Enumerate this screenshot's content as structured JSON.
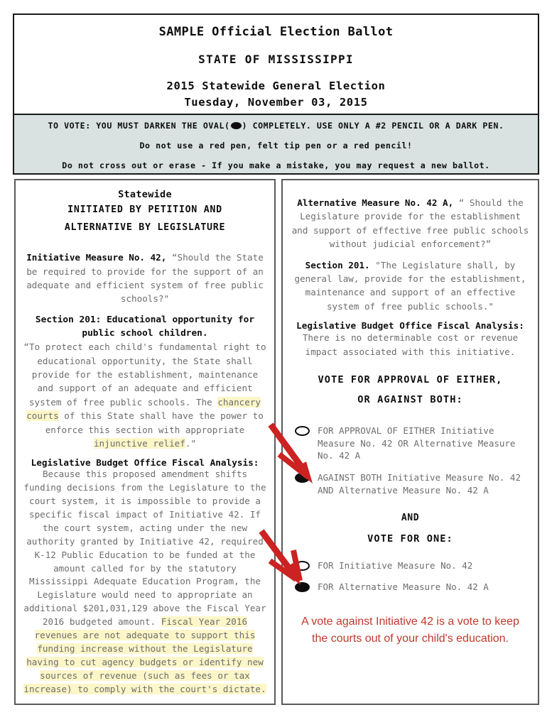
{
  "header": {
    "title_main": "SAMPLE Official Election Ballot",
    "title_state": "STATE OF MISSISSIPPI",
    "title_election": "2015 Statewide General Election",
    "title_date": "Tuesday, November 03, 2015"
  },
  "instructions": {
    "line1_before_oval": "TO VOTE: YOU MUST DARKEN THE OVAL(",
    "line1_after_oval": ") COMPLETELY. USE ONLY A #2 PENCIL OR A DARK PEN.",
    "line2": "Do not use a red pen, felt tip pen or a red pencil!",
    "line3": "Do not cross out or erase - If you make a mistake, you may request a new ballot."
  },
  "left_column": {
    "heading_statewide": "Statewide",
    "heading_initiated_l1": "INITIATED BY PETITION AND",
    "heading_initiated_l2": "ALTERNATIVE BY LEGISLATURE",
    "initiative_lead": "Initiative Measure No. 42,",
    "initiative_text": " “Should the State be required to provide for the support of an adequate and efficient system of free public schools?\"",
    "section_head_l1": "Section 201: Educational opportunity for",
    "section_head_l2": "public school children.",
    "section_text_a": "“To protect each child's fundamental right to educational opportunity, the State shall provide for the establishment, maintenance and support of an adequate and efficient system of free public schools. The ",
    "section_hl_1": "chancery courts",
    "section_text_b": " of this State shall have the power to enforce this section with appropriate ",
    "section_hl_2": "injunctive relief",
    "section_text_c": ".\"",
    "lbo_head": "Legislative Budget Office Fiscal Analysis:",
    "lbo_text_a": "Because this proposed amendment shifts funding decisions from the Legislature to the court system, it is impossible to provide a specific fiscal impact of Initiative 42.  If the court system, acting under the new authority granted by Initiative 42, required K-12 Public Education to be funded at the amount called for by the statutory Mississippi Adequate Education Program, the Legislature would need to appropriate an additional $201,031,129 above the Fiscal Year 2016 budgeted amount.  ",
    "lbo_hl_block": "Fiscal Year 2016 revenues are not adequate to support this funding increase without the Legislature having to cut agency budgets or identify new sources of revenue (such as fees or tax increase) to comply with the court's dictate."
  },
  "right_column": {
    "alt_lead": "Alternative Measure No. 42 A,",
    "alt_text": " “ Should the Legislature provide for the establishment and support of effective free public schools without judicial enforcement?”",
    "section_lead": "Section 201.",
    "section_text": " \"The Legislature shall, by general law, provide for the establishment, maintenance and support of an effective system of free public schools.\"",
    "lbo_head": "Legislative Budget Office Fiscal Analysis:",
    "lbo_text": "There is no determinable cost or revenue impact associated with this initiative.",
    "vote_head_l1": "VOTE FOR APPROVAL OF EITHER,",
    "vote_head_l2": "OR AGAINST BOTH:",
    "option_1": "FOR APPROVAL OF EITHER Initiative Measure No. 42 OR Alternative Measure No. 42 A",
    "option_1_state": "empty",
    "option_2": "AGAINST BOTH Initiative Measure No. 42 AND Alternative Measure No. 42 A",
    "option_2_state": "filled",
    "and_word": "AND",
    "vote_one_head": "VOTE FOR ONE:",
    "option_3": "FOR Initiative Measure No. 42",
    "option_3_state": "empty",
    "option_4": "FOR Alternative Measure No. 42 A",
    "option_4_state": "filled",
    "red_note_l1": "A vote against Initiative 42 is a vote to keep",
    "red_note_l2": "the courts out of your child's education."
  },
  "colors": {
    "instruction_band": "#d9e1e1",
    "highlight_yellow": "#fcf6c8",
    "annotation_red": "#c0392b",
    "body_text_gray": "#6d6d6d",
    "heading_black": "#0d0d0d"
  }
}
